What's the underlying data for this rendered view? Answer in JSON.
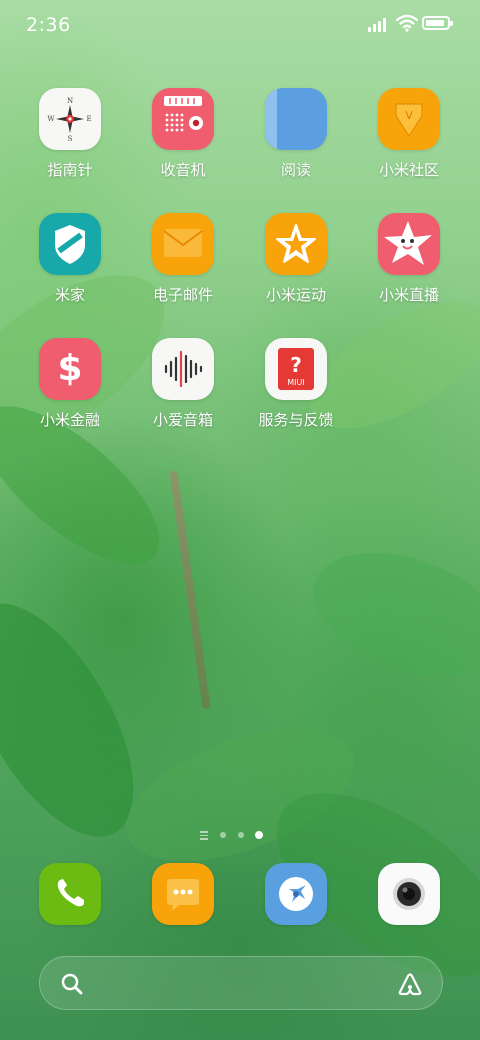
{
  "status_bar": {
    "time": "2:36",
    "battery_level": 0.9
  },
  "apps": [
    {
      "label": "指南针",
      "icon": "compass-icon"
    },
    {
      "label": "收音机",
      "icon": "radio-icon"
    },
    {
      "label": "阅读",
      "icon": "book-icon"
    },
    {
      "label": "小米社区",
      "icon": "mi-community-icon"
    },
    {
      "label": "米家",
      "icon": "mijia-shield-icon"
    },
    {
      "label": "电子邮件",
      "icon": "email-icon"
    },
    {
      "label": "小米运动",
      "icon": "star-badge-icon"
    },
    {
      "label": "小米直播",
      "icon": "star-face-icon"
    },
    {
      "label": "小米金融",
      "icon": "dollar-icon"
    },
    {
      "label": "小爱音箱",
      "icon": "soundwave-icon"
    },
    {
      "label": "服务与反馈",
      "icon": "service-feedback-icon"
    }
  ],
  "compass": {
    "n": "N",
    "s": "S",
    "e": "E",
    "w": "W"
  },
  "service_badge_text": "MIUI",
  "pager": {
    "pages": 3,
    "current": 3
  },
  "dock": [
    {
      "icon": "phone-icon"
    },
    {
      "icon": "messages-icon"
    },
    {
      "icon": "browser-icon"
    },
    {
      "icon": "camera-icon"
    }
  ],
  "colors": {
    "red": "#ef5d6f",
    "orange": "#f9a30b",
    "blue": "#5aa0e0",
    "teal": "#17a9a9",
    "green": "#6cbb12",
    "white": "#ffffff"
  }
}
